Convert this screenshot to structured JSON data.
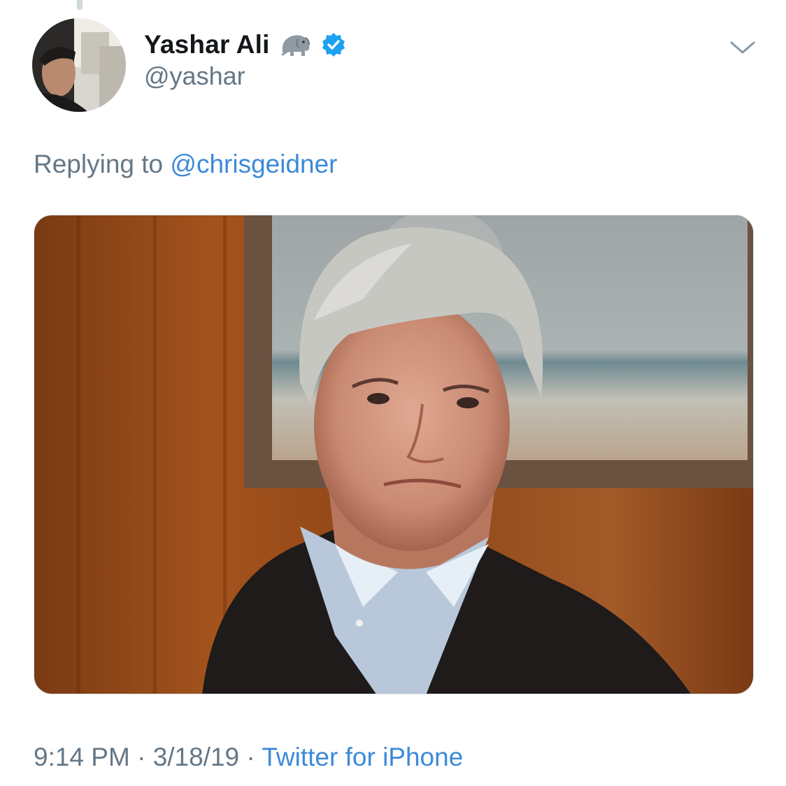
{
  "tweet": {
    "display_name": "Yashar Ali",
    "name_emoji": "🐘",
    "handle": "@yashar",
    "reply_prefix": "Replying to",
    "reply_handle": "@chrisgeidner",
    "time": "9:14 PM",
    "separator": "·",
    "date": "3/18/19",
    "source": "Twitter for iPhone"
  },
  "icons": {
    "menu": "chevron-down-icon",
    "verified": "verified-badge-icon",
    "emoji": "elephant-icon"
  },
  "colors": {
    "name": "#14171a",
    "secondary_text": "#657786",
    "link": "#3c8ad9",
    "verified": "#1da1f2",
    "chevron": "#8899a6"
  }
}
